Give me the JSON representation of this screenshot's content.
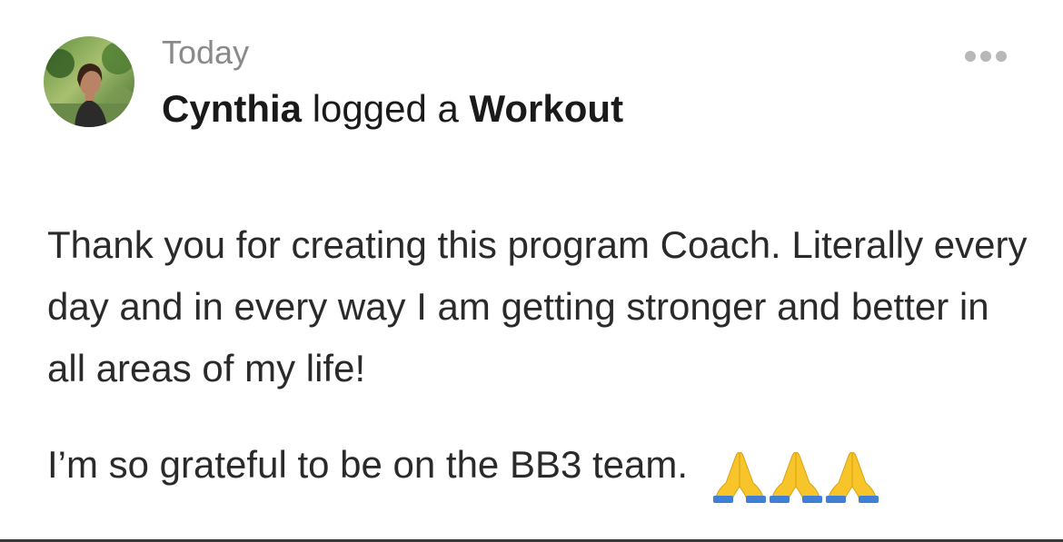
{
  "post": {
    "timestamp": "Today",
    "author": "Cynthia",
    "action_verb": "logged a",
    "activity_type": "Workout",
    "more_menu_icon": "ellipsis-horizontal-icon",
    "avatar_icon": "user-avatar-photo",
    "message_paragraph_1": "Thank you for creating this program Coach. Literally every day and in every way I am getting stronger and better in all areas of my life!",
    "message_paragraph_2": "I’m so grateful to be on the BB3 team.",
    "reaction_emoji": "folded-hands-icon",
    "reaction_emoji_count": 3
  },
  "colors": {
    "timestamp": "#8a8a8a",
    "headline": "#1a1a1a",
    "body": "#2a2a2a",
    "menu_dots": "#b8b8b8",
    "divider": "#3a3a3a"
  }
}
